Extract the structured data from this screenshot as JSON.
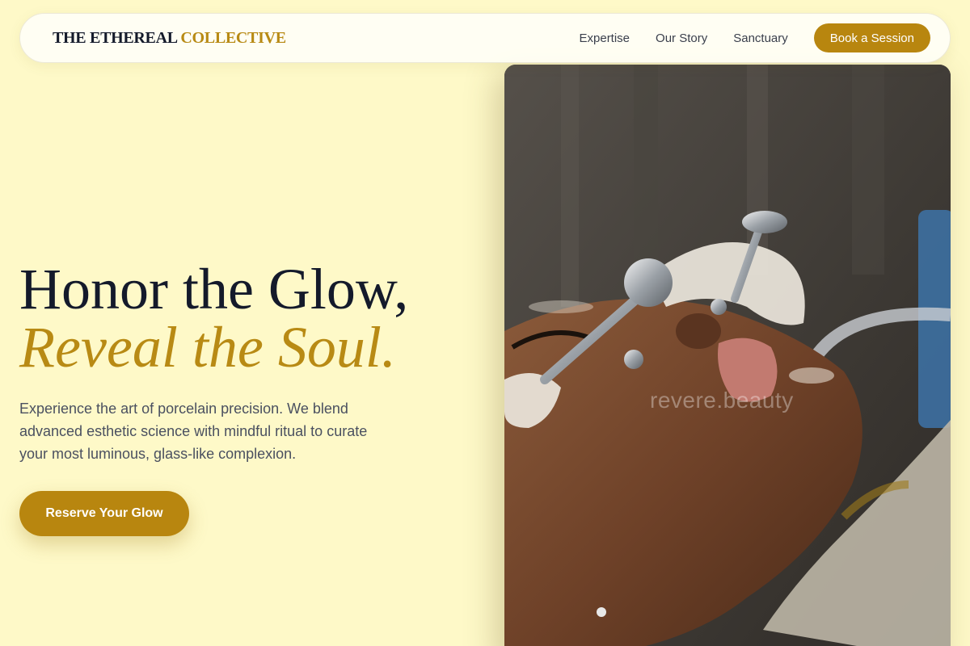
{
  "brand": {
    "name_part1": "THE ETHEREAL",
    "name_part2": "COLLECTIVE"
  },
  "nav": {
    "links": [
      "Expertise",
      "Our Story",
      "Sanctuary"
    ],
    "cta_label": "Book a Session"
  },
  "hero": {
    "title_line1": "Honor the Glow,",
    "title_line2": "Reveal the Soul.",
    "description": "Experience the art of porcelain precision. We blend advanced esthetic science with mindful ritual to curate your most luminous, glass-like complexion.",
    "cta_label": "Reserve Your Glow"
  },
  "image": {
    "subject": "facial treatment with cooling steel globes",
    "watermark": "revere.beauty"
  },
  "colors": {
    "background": "#fef9c8",
    "accent": "#b8860f",
    "text_dark": "#141a2b"
  }
}
